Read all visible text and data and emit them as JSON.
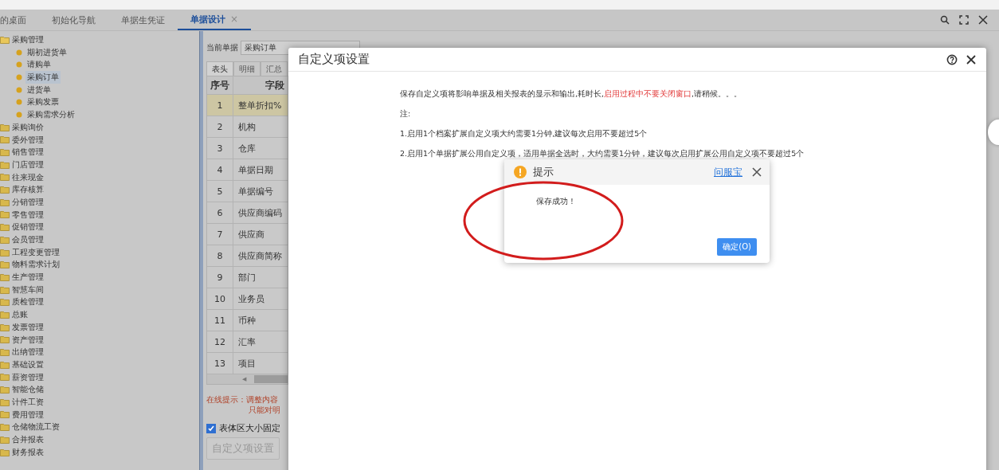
{
  "tabs": [
    {
      "label": "的桌面",
      "selected": false,
      "closable": false
    },
    {
      "label": "初始化导航",
      "selected": false,
      "closable": false
    },
    {
      "label": "单据生凭证",
      "selected": false,
      "closable": false
    },
    {
      "label": "单据设计",
      "selected": true,
      "closable": true
    }
  ],
  "tab_close": "×",
  "sidebar": {
    "items": [
      {
        "label": "采购管理",
        "expanded": true,
        "children": [
          {
            "label": "期初进货单",
            "selected": false
          },
          {
            "label": "请购单",
            "selected": false
          },
          {
            "label": "采购订单",
            "selected": true
          },
          {
            "label": "进货单",
            "selected": false
          },
          {
            "label": "采购发票",
            "selected": false
          },
          {
            "label": "采购需求分析",
            "selected": false
          }
        ]
      },
      {
        "label": "采购询价",
        "expanded": false
      },
      {
        "label": "委外管理",
        "expanded": false
      },
      {
        "label": "销售管理",
        "expanded": false
      },
      {
        "label": "门店管理",
        "expanded": false
      },
      {
        "label": "往来现金",
        "expanded": false
      },
      {
        "label": "库存核算",
        "expanded": false
      },
      {
        "label": "分销管理",
        "expanded": false
      },
      {
        "label": "零售管理",
        "expanded": false
      },
      {
        "label": "促销管理",
        "expanded": false
      },
      {
        "label": "会员管理",
        "expanded": false
      },
      {
        "label": "工程变更管理",
        "expanded": false
      },
      {
        "label": "物料需求计划",
        "expanded": false
      },
      {
        "label": "生产管理",
        "expanded": false
      },
      {
        "label": "智慧车间",
        "expanded": false
      },
      {
        "label": "质检管理",
        "expanded": false
      },
      {
        "label": "总账",
        "expanded": false
      },
      {
        "label": "发票管理",
        "expanded": false
      },
      {
        "label": "资产管理",
        "expanded": false
      },
      {
        "label": "出纳管理",
        "expanded": false
      },
      {
        "label": "基础设置",
        "expanded": false
      },
      {
        "label": "薪资管理",
        "expanded": false
      },
      {
        "label": "智能仓储",
        "expanded": false
      },
      {
        "label": "计件工资",
        "expanded": false
      },
      {
        "label": "费用管理",
        "expanded": false
      },
      {
        "label": "仓储物流工资",
        "expanded": false
      },
      {
        "label": "合并报表",
        "expanded": false
      },
      {
        "label": "财务报表",
        "expanded": false
      }
    ]
  },
  "designer": {
    "current_label": "当前单据",
    "current_value": "采购订单",
    "sub_tabs": [
      {
        "label": "表头",
        "selected": true
      },
      {
        "label": "明细",
        "selected": false
      },
      {
        "label": "汇总",
        "selected": false
      }
    ],
    "table": {
      "columns": [
        "序号",
        "字段"
      ],
      "rows": [
        {
          "no": "1",
          "field": "整单折扣%",
          "selected": true
        },
        {
          "no": "2",
          "field": "机构",
          "selected": false
        },
        {
          "no": "3",
          "field": "仓库",
          "selected": false
        },
        {
          "no": "4",
          "field": "单据日期",
          "selected": false
        },
        {
          "no": "5",
          "field": "单据编号",
          "selected": false
        },
        {
          "no": "6",
          "field": "供应商编码",
          "selected": false
        },
        {
          "no": "7",
          "field": "供应商",
          "selected": false
        },
        {
          "no": "8",
          "field": "供应商简称",
          "selected": false
        },
        {
          "no": "9",
          "field": "部门",
          "selected": false
        },
        {
          "no": "10",
          "field": "业务员",
          "selected": false
        },
        {
          "no": "11",
          "field": "币种",
          "selected": false
        },
        {
          "no": "12",
          "field": "汇率",
          "selected": false
        },
        {
          "no": "13",
          "field": "项目",
          "selected": false
        }
      ]
    },
    "scroll_arrow": "◀",
    "hint_lines": [
      "在线提示：调整内容",
      "只能对明"
    ],
    "fixed_size": {
      "label": "表体区大小固定",
      "checked": true
    },
    "custom_button": "自定义项设置"
  },
  "modal": {
    "title": "自定义项设置",
    "paragraphs": [
      [
        {
          "text": "保存自定义项将影响单据及相关报表的显示和输出,耗时长,",
          "kind": "normal"
        },
        {
          "text": "启用过程中不要关闭窗口",
          "kind": "warning"
        },
        {
          "text": ",请稍候。。。",
          "kind": "normal"
        }
      ],
      [
        {
          "text": "注:",
          "kind": "normal"
        }
      ],
      [
        {
          "text": "1.启用1个档案扩展自定义项大约需要1分钟,建议每次启用不要超过5个",
          "kind": "normal"
        }
      ],
      [
        {
          "text": "2.启用1个单据扩展公用自定义项，适用单据全选时，大约需要1分钟，建议每次启用扩展公用自定义项不要超过5个",
          "kind": "normal"
        }
      ]
    ]
  },
  "alert": {
    "title": "提示",
    "help_link": "问服宝",
    "message": "保存成功！",
    "ok_button": "确定(O)"
  }
}
